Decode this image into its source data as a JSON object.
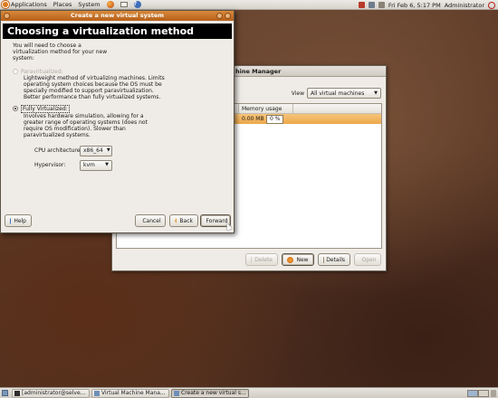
{
  "top_panel": {
    "menu": [
      "Applications",
      "Places",
      "System"
    ],
    "clock": "Fri Feb  6,  5:17 PM",
    "user": "Administrator"
  },
  "vm_manager": {
    "title": "Virtual Machine Manager",
    "title_visible": "hine Manager",
    "view_label": "View",
    "view_value": "All virtual machines",
    "columns": [
      "usage",
      "Memory usage"
    ],
    "row": {
      "cpu": "%",
      "memory": "0.00 MB",
      "memory_pct": "0 %"
    },
    "buttons": {
      "delete": "Delete",
      "new": "New",
      "details": "Details",
      "open": "Open"
    }
  },
  "wizard": {
    "title": "Create a new virtual system",
    "header": "Choosing a virtualization method",
    "intro": [
      "You will need to choose a",
      "virtualization method for your new",
      "system:"
    ],
    "para_label": "Paravirtualized:",
    "para_desc": [
      "Lightweight method of virtualizing machines. Limits",
      "operating system choices because the OS must be",
      "specially modified to support paravirtualization.",
      "Better performance than fully virtualized systems."
    ],
    "full_label": "Fully Virtualized:",
    "full_desc": [
      "Involves hardware simulation, allowing for a",
      "greater range of operating systems (does not",
      "require OS modification). Slower than",
      "paravirtualized systems."
    ],
    "cpu_label": "CPU architecture:",
    "cpu_value": "x86_64",
    "hyp_label": "Hypervisor:",
    "hyp_value": "kvm",
    "buttons": {
      "help": "Help",
      "cancel": "Cancel",
      "back": "Back",
      "forward": "Forward"
    }
  },
  "taskbar": {
    "tasks": [
      "[administrator@selve...",
      "Virtual Machine Mana...",
      "Create a new virtual s..."
    ]
  },
  "colors": {
    "accent": "#e39a34",
    "selection": "#f0b25f",
    "titlebar": "#c8732a"
  }
}
